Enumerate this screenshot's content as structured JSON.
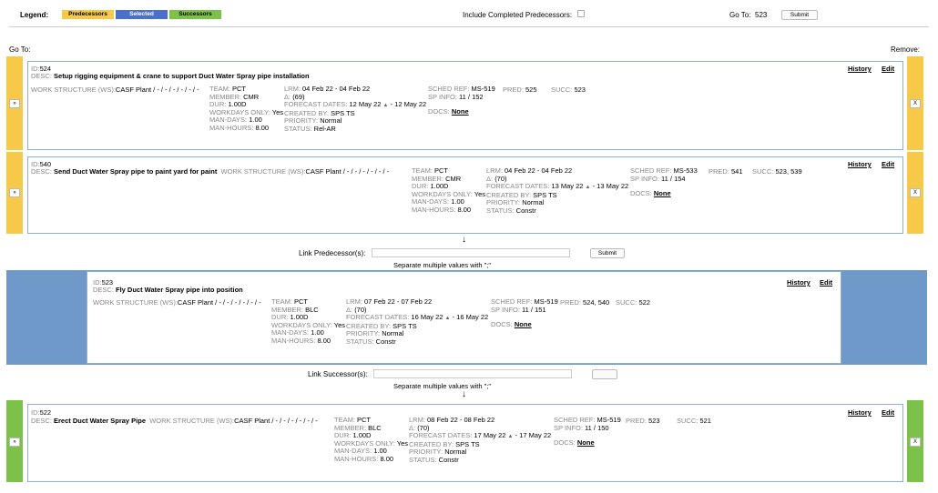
{
  "legend": {
    "title": "Legend:",
    "pred": "Predecessors",
    "sel": "Selected",
    "succ": "Successors"
  },
  "colors": {
    "pred": "#f7c948",
    "sel": "#4a6fcf",
    "succ": "#7cc14a",
    "selBand": "#6f99c8"
  },
  "top": {
    "include_label": "Include Completed Predecessors:",
    "goto_label": "Go To:",
    "goto_value": "523",
    "submit": "Submit"
  },
  "goto_left": "Go To:",
  "remove_right": "Remove:",
  "labels": {
    "id": "ID:",
    "desc": "DESC:",
    "ws": "WORK STRUCTURE (WS):",
    "team": "TEAM:",
    "member": "MEMBER:",
    "dur": "DUR:",
    "workdays": "WORKDAYS ONLY:",
    "mandays": "MAN-DAYS:",
    "manhours": "MAN-HOURS:",
    "lrm": "LRM:",
    "delta": "Δ:",
    "forecast": "FORECAST DATES:",
    "created": "CREATED BY:",
    "priority": "PRIORITY:",
    "status": "STATUS:",
    "sched": "SCHED REF:",
    "spinfo": "SP INFO:",
    "pred": "PRED:",
    "succ": "SUCC:",
    "docs": "DOCS:",
    "history": "History",
    "edit": "Edit",
    "go_btn": "»",
    "remove_btn": "X"
  },
  "cards": [
    {
      "id": "524",
      "desc": "Setup rigging equipment & crane to support Duct Water Spray pipe installation",
      "ws": "CASF Plant / - / - / - / - / - / -",
      "team": "PCT",
      "member": "CMR",
      "dur": "1.00D",
      "workdays": "Yes",
      "mandays": "1.00",
      "manhours": "8.00",
      "lrm": "04 Feb 22 - 04 Feb 22",
      "delta": "(69)",
      "fc_start": "12 May 22",
      "fc_end": "12 May 22",
      "created": "SPS TS",
      "priority": "Normal",
      "status": "Rel-AR",
      "sched": "MS-519",
      "spinfo": "11 / 152",
      "pred": "525",
      "succ": "523",
      "docs": "None"
    },
    {
      "id": "540",
      "desc": "Send Duct Water Spray pipe to paint yard for paint",
      "ws": "CASF Plant / - / - / - / - / - / -",
      "team": "PCT",
      "member": "CMR",
      "dur": "1.00D",
      "workdays": "Yes",
      "mandays": "1.00",
      "manhours": "8.00",
      "lrm": "04 Feb 22 - 04 Feb 22",
      "delta": "(70)",
      "fc_start": "13 May 22",
      "fc_end": "13 May 22",
      "created": "SPS TS",
      "priority": "Normal",
      "status": "Constr",
      "sched": "MS-533",
      "spinfo": "11 / 154",
      "pred": "541",
      "succ": "523, 539",
      "docs": "None"
    },
    {
      "id": "523",
      "desc": "Fly Duct Water Spray pipe into position",
      "ws": "CASF Plant / - / - / - / - / - / -",
      "team": "PCT",
      "member": "BLC",
      "dur": "1.00D",
      "workdays": "Yes",
      "mandays": "1.00",
      "manhours": "8.00",
      "lrm": "07 Feb 22 - 07 Feb 22",
      "delta": "(70)",
      "fc_start": "16 May 22",
      "fc_end": "16 May 22",
      "created": "SPS TS",
      "priority": "Normal",
      "status": "Constr",
      "sched": "MS-519",
      "spinfo": "11 / 151",
      "pred": "524, 540",
      "succ": "522",
      "docs": "None"
    },
    {
      "id": "522",
      "desc": "Erect Duct Water Spray Pipe",
      "ws": "CASF Plant / - / - / - / - / - / -",
      "team": "PCT",
      "member": "BLC",
      "dur": "1.00D",
      "workdays": "Yes",
      "mandays": "1.00",
      "manhours": "8.00",
      "lrm": "08 Feb 22 - 08 Feb 22",
      "delta": "(70)",
      "fc_start": "17 May 22",
      "fc_end": "17 May 22",
      "created": "SPS TS",
      "priority": "Normal",
      "status": "Constr",
      "sched": "MS-519",
      "spinfo": "11 / 150",
      "pred": "523",
      "succ": "521",
      "docs": "None"
    }
  ],
  "link_pred": {
    "label": "Link Predecessor(s):",
    "hint": "Separate multiple values with \";\"",
    "submit": "Submit"
  },
  "link_succ": {
    "label": "Link Successor(s):",
    "hint": "Separate multiple values with \";\""
  },
  "arrow": "↓",
  "tri": "▲"
}
